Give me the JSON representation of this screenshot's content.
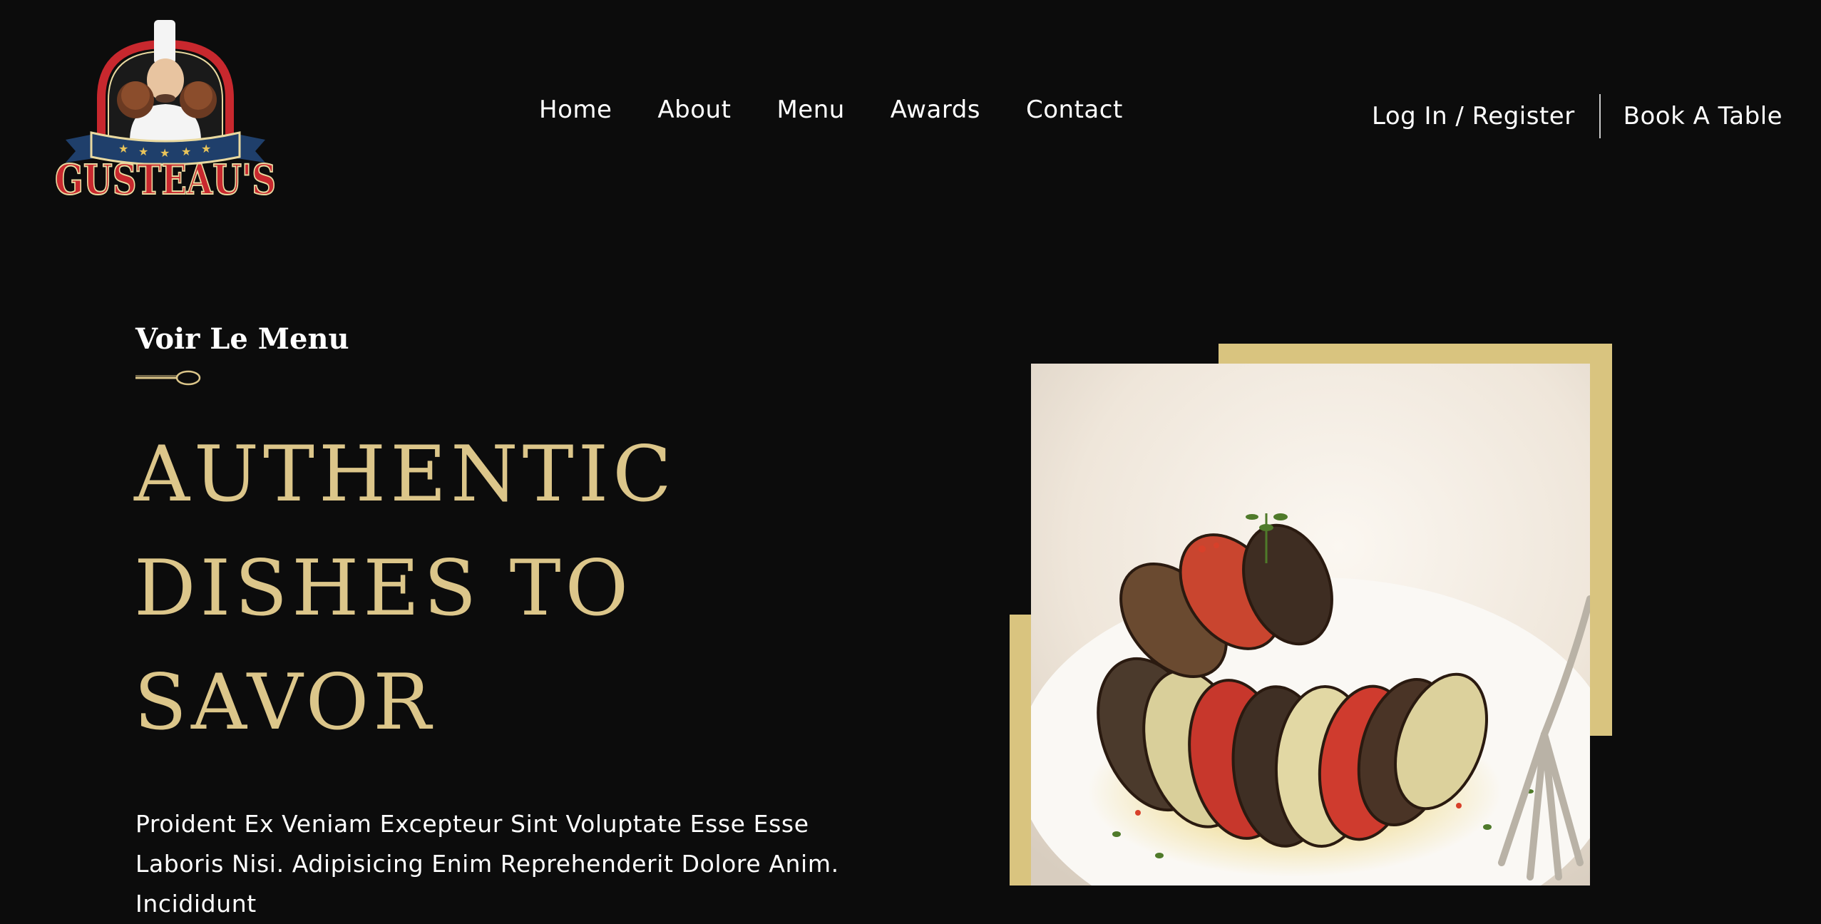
{
  "brand": {
    "name": "GUSTEAU'S"
  },
  "nav": {
    "items": [
      {
        "label": "Home"
      },
      {
        "label": "About"
      },
      {
        "label": "Menu"
      },
      {
        "label": "Awards"
      },
      {
        "label": "Contact"
      }
    ]
  },
  "auth": {
    "login_label": "Log In / Register",
    "book_label": "Book A Table"
  },
  "hero": {
    "eyebrow": "Voir Le Menu",
    "headline_lines": [
      "AUTHENTIC",
      "DISHES TO",
      "SAVOR"
    ],
    "description": "Proident Ex Veniam Excepteur Sint Voluptate Esse Esse Laboris Nisi. Adipisicing Enim Reprehenderit Dolore Anim. Incididunt"
  },
  "colors": {
    "background": "#0c0c0c",
    "accent_gold": "#dcc68a",
    "logo_red": "#c8282e",
    "logo_navy": "#1f3f6b"
  },
  "icons": {
    "divider_icon": "spoon-icon",
    "logo_icon": "chef-logo-icon"
  }
}
